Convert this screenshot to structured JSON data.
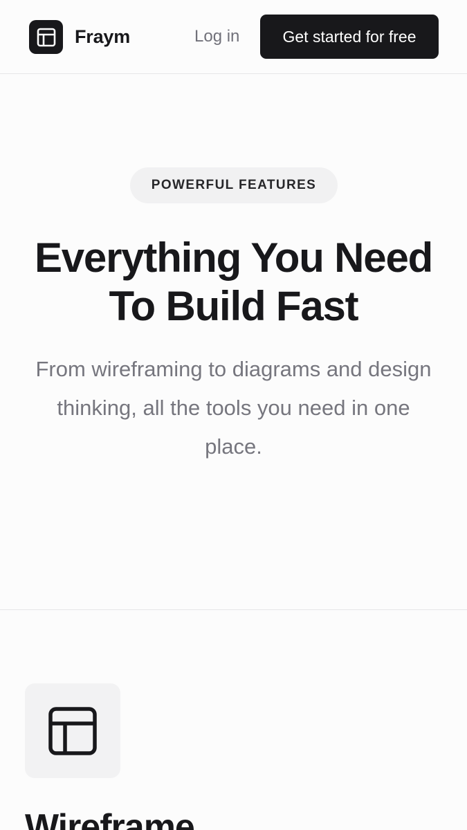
{
  "header": {
    "brand_name": "Fraym",
    "brand_icon": "layout-icon",
    "login_label": "Log in",
    "cta_label": "Get started for free"
  },
  "hero": {
    "badge": "POWERFUL FEATURES",
    "title_line1": "Everything You Need",
    "title_line2": "To Build Fast",
    "subtitle": "From wireframing to diagrams and design thinking, all the tools you need in one place."
  },
  "features": [
    {
      "icon": "layout-icon",
      "title": "Wireframe"
    }
  ],
  "colors": {
    "background": "#fcfcfc",
    "primary": "#18181b",
    "muted_text": "#71717a",
    "badge_bg": "#f1f1f2",
    "divider": "#e6e6e8"
  }
}
